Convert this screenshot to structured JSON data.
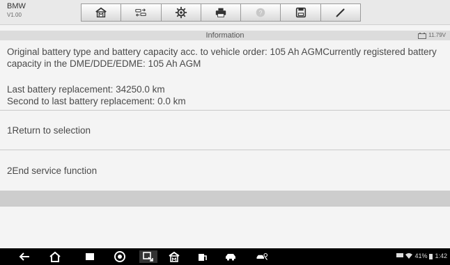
{
  "app": {
    "brand": "BMW",
    "version": "V1.00"
  },
  "toolbar": {
    "buttons": [
      {
        "icon": "home-icon"
      },
      {
        "icon": "vehicle-swap-icon"
      },
      {
        "icon": "settings-icon"
      },
      {
        "icon": "print-icon"
      },
      {
        "icon": "help-icon"
      },
      {
        "icon": "save-icon"
      },
      {
        "icon": "edit-icon"
      }
    ]
  },
  "info": {
    "title": "Information",
    "voltage": "11.79V"
  },
  "content": {
    "battery_info": "Original battery type and battery capacity acc. to vehicle order: 105 Ah AGMCurrently registered battery capacity in the DME/DDE/EDME: 105 Ah AGM",
    "last_replacement": "Last battery replacement: 34250.0 km",
    "second_last_replacement": "Second to last battery replacement: 0.0 km"
  },
  "options": [
    {
      "label": "1Return to selection"
    },
    {
      "label": "2End service function"
    }
  ],
  "system": {
    "battery_percent": "41%",
    "time": "1:42"
  },
  "colors": {
    "accent_disabled": "#bdbdbd",
    "band": "#cdcdcd"
  }
}
